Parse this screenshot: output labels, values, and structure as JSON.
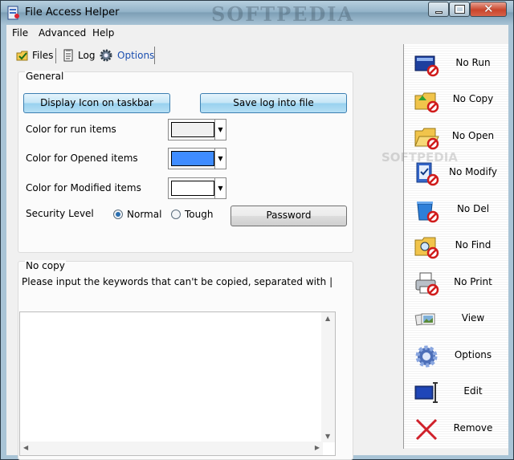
{
  "window": {
    "title": "File Access Helper",
    "watermark": "SOFTPEDIA"
  },
  "menu": [
    "File",
    "Advanced",
    "Help"
  ],
  "tabs": [
    {
      "label": "Files",
      "icon": "folder-check-icon",
      "active": false
    },
    {
      "label": "Log",
      "icon": "log-icon",
      "active": false
    },
    {
      "label": "Options",
      "icon": "gear-icon",
      "active": true
    }
  ],
  "general": {
    "title": "General",
    "display_icon_button": "Display Icon on taskbar",
    "save_log_button": "Save log into file",
    "color_run_label": "Color for run items",
    "color_opened_label": "Color for Opened items",
    "color_modified_label": "Color for Modified items",
    "color_run_value": "#f0f0f0",
    "color_opened_value": "#3f8cff",
    "color_modified_value": "#ffffff",
    "security_label": "Security Level",
    "radio_normal": "Normal",
    "radio_tough": "Tough",
    "security_selected": "Normal",
    "password_button": "Password"
  },
  "nocopy": {
    "title": "No copy",
    "instruction": "Please input the keywords that can't be copied, separated with |",
    "keywords": ""
  },
  "toolbar": [
    {
      "label": "No Run",
      "icon": "no-run-icon"
    },
    {
      "label": "No Copy",
      "icon": "no-copy-icon"
    },
    {
      "label": "No Open",
      "icon": "no-open-icon"
    },
    {
      "label": "No Modify",
      "icon": "no-modify-icon"
    },
    {
      "label": "No Del",
      "icon": "no-del-icon"
    },
    {
      "label": "No Find",
      "icon": "no-find-icon"
    },
    {
      "label": "No Print",
      "icon": "no-print-icon"
    },
    {
      "label": "View",
      "icon": "view-icon"
    },
    {
      "label": "Options",
      "icon": "options-gear-icon"
    },
    {
      "label": "Edit",
      "icon": "edit-icon"
    },
    {
      "label": "Remove",
      "icon": "remove-icon"
    }
  ],
  "toolbar_watermark": "SOFTPEDIA"
}
